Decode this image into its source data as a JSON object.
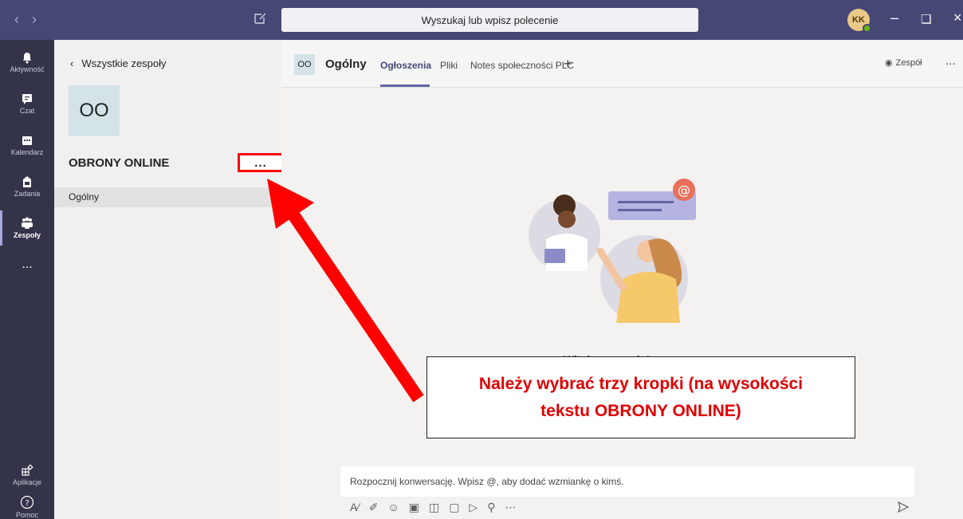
{
  "titlebar": {
    "search_placeholder": "Wyszukaj lub wpisz polecenie",
    "avatar_initials": "KK"
  },
  "appbar": {
    "items": [
      {
        "label": "Aktywność",
        "icon": "bell-icon"
      },
      {
        "label": "Czat",
        "icon": "chat-icon"
      },
      {
        "label": "Kalendarz",
        "icon": "calendar-icon"
      },
      {
        "label": "Zadania",
        "icon": "assignments-icon"
      },
      {
        "label": "Zespoły",
        "icon": "teams-icon"
      },
      {
        "label": "Aplikacje",
        "icon": "apps-icon"
      },
      {
        "label": "Pomoc",
        "icon": "help-icon"
      }
    ],
    "more": "..."
  },
  "teampanel": {
    "back_label": "Wszystkie zespoły",
    "tile_initials": "OO",
    "team_name": "OBRONY ONLINE",
    "more": "...",
    "channels": [
      "Ogólny"
    ]
  },
  "main": {
    "channel_badge": "OO",
    "channel_title": "Ogólny",
    "tabs": [
      "Ogłoszenia",
      "Pliki",
      "Notes społeczności PLC"
    ],
    "tab_add": "+",
    "team_button": "Zespół",
    "header_more": "...",
    "welcome_text": "Witaj w zespole!",
    "compose_placeholder": "Rozpocznij konwersację. Wpisz @, aby dodać wzmiankę o kimś."
  },
  "annotation": {
    "line1": "Należy wybrać trzy kropki (na wysokości",
    "line2": "tekstu OBRONY ONLINE)"
  },
  "colors": {
    "titlebar": "#464775",
    "appbar": "#33344a",
    "accent": "#6264a7",
    "annotation": "#ff0000"
  }
}
